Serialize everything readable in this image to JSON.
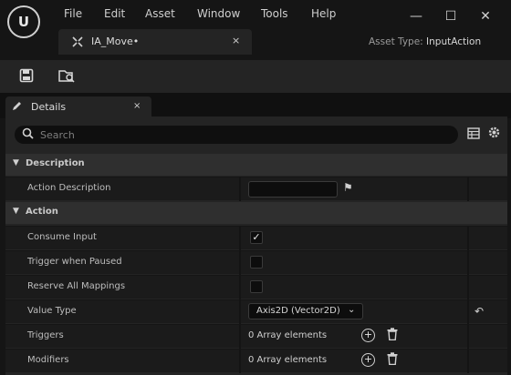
{
  "menu": [
    "File",
    "Edit",
    "Asset",
    "Window",
    "Tools",
    "Help"
  ],
  "logo": "U",
  "window_controls": {
    "minimize": "—",
    "maximize": "☐",
    "close": "✕"
  },
  "tab": {
    "icon": "input-action-icon",
    "label": "IA_Move•",
    "close": "×"
  },
  "asset_type": {
    "label": "Asset Type:",
    "value": "InputAction"
  },
  "toolbar": {
    "save_icon": "save-icon",
    "browse_icon": "browse-icon"
  },
  "details": {
    "tab_label": "Details",
    "close": "×"
  },
  "search": {
    "placeholder": "Search"
  },
  "categories": [
    {
      "label": "Description",
      "properties": [
        {
          "name": "Action Description",
          "type": "text",
          "value": ""
        }
      ]
    },
    {
      "label": "Action",
      "properties": [
        {
          "name": "Consume Input",
          "type": "checkbox",
          "checked": true
        },
        {
          "name": "Trigger when Paused",
          "type": "checkbox",
          "checked": false
        },
        {
          "name": "Reserve All Mappings",
          "type": "checkbox",
          "checked": false
        },
        {
          "name": "Value Type",
          "type": "combo",
          "value": "Axis2D (Vector2D)"
        },
        {
          "name": "Triggers",
          "type": "array",
          "value": "0 Array elements"
        },
        {
          "name": "Modifiers",
          "type": "array",
          "value": "0 Array elements"
        }
      ]
    }
  ],
  "colors": {
    "bg": "#151515",
    "panel": "#242424",
    "row": "#1b1b1b",
    "category": "#2f2f2f"
  }
}
